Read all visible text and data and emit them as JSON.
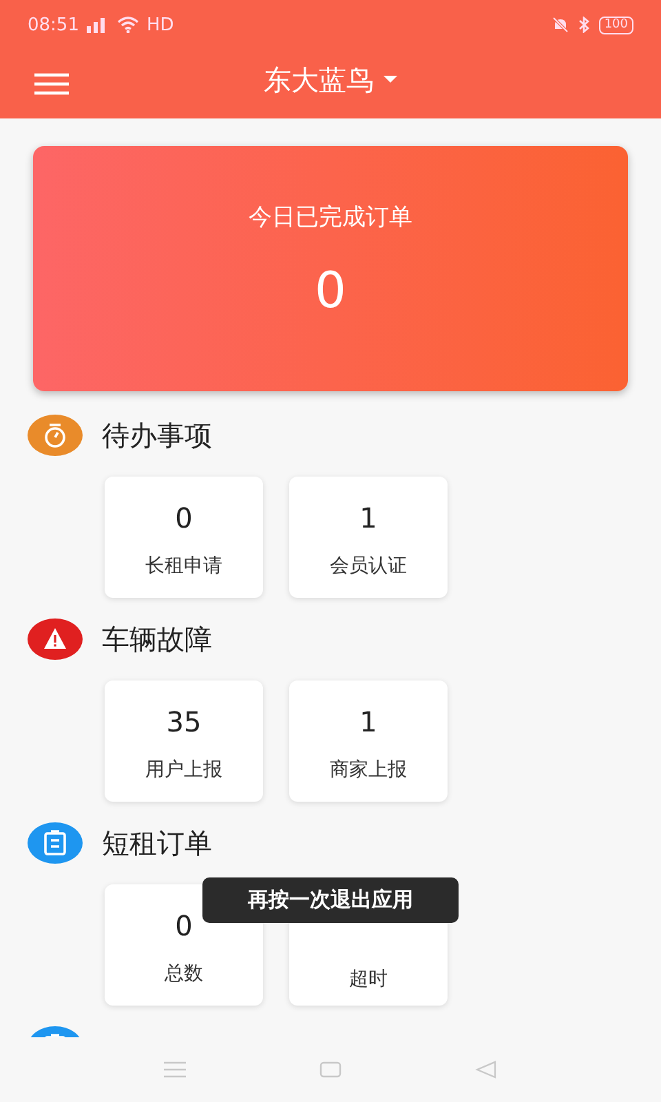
{
  "status_bar": {
    "time": "08:51",
    "network": "HD",
    "battery": "100"
  },
  "header": {
    "title": "东大蓝鸟"
  },
  "summary": {
    "label": "今日已完成订单",
    "value": "0"
  },
  "sections": [
    {
      "title": "待办事项",
      "kind": "timer",
      "color": "#e98b2a",
      "tiles": [
        {
          "value": "0",
          "label": "长租申请"
        },
        {
          "value": "1",
          "label": "会员认证"
        }
      ]
    },
    {
      "title": "车辆故障",
      "kind": "warning",
      "color": "#e02020",
      "tiles": [
        {
          "value": "35",
          "label": "用户上报"
        },
        {
          "value": "1",
          "label": "商家上报"
        }
      ]
    },
    {
      "title": "短租订单",
      "kind": "clipboard",
      "color": "#1e96f0",
      "tiles": [
        {
          "value": "0",
          "label": "总数"
        },
        {
          "label": "超时"
        }
      ]
    },
    {
      "kind": "clipboard",
      "color": "#1e96f0"
    }
  ],
  "toast": "再按一次退出应用"
}
